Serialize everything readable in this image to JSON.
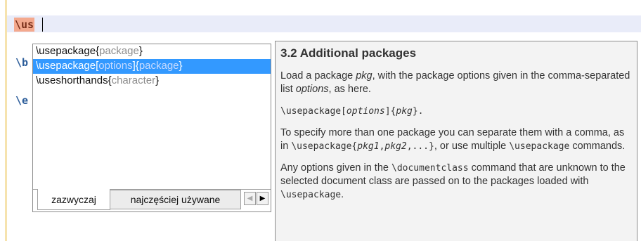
{
  "editor": {
    "typed_text": "\\us",
    "code_fragment_1": "\\b",
    "code_fragment_2": "\\e"
  },
  "completer": {
    "items": [
      {
        "command": "\\usepackage",
        "parts": [
          {
            "text": "{"
          },
          {
            "text": "package",
            "ph": true
          },
          {
            "text": "}"
          }
        ]
      },
      {
        "command": "\\usepackage",
        "parts": [
          {
            "text": "["
          },
          {
            "text": "options",
            "ph": true
          },
          {
            "text": "]{"
          },
          {
            "text": "package",
            "ph": true
          },
          {
            "text": "}"
          }
        ]
      },
      {
        "command": "\\useshorthands",
        "parts": [
          {
            "text": "{"
          },
          {
            "text": "character",
            "ph": true
          },
          {
            "text": "}"
          }
        ]
      }
    ],
    "selected_index": 1,
    "tabs": {
      "tab1": "zazwyczaj",
      "tab2": "najczęściej używane"
    },
    "scroll_left_glyph": "◀",
    "scroll_right_glyph": "▶"
  },
  "doc": {
    "title": "3.2 Additional packages",
    "p1": {
      "a": "Load a package ",
      "pkg": "pkg",
      "b": ", with the package options given in the comma-separated list ",
      "options": "options",
      "c": ", as here."
    },
    "code_line": {
      "a": "\\usepackage[",
      "options": "options",
      "b": "]{",
      "pkg": "pkg",
      "c": "}."
    },
    "p2": {
      "a": "To specify more than one package you can separate them with a comma, as in ",
      "code1": "\\usepackage{",
      "pkg1": "pkg1",
      "mid": ",",
      "pkg2": "pkg2",
      "code2": ",...}",
      "b": ", or use multiple ",
      "code3": "\\usepackage",
      "c": " commands."
    },
    "p3": {
      "a": "Any options given in the ",
      "code1": "\\documentclass",
      "b": " command that are unknown to the selected document class are passed on to the packages loaded with ",
      "code2": "\\usepackage",
      "c": "."
    }
  }
}
